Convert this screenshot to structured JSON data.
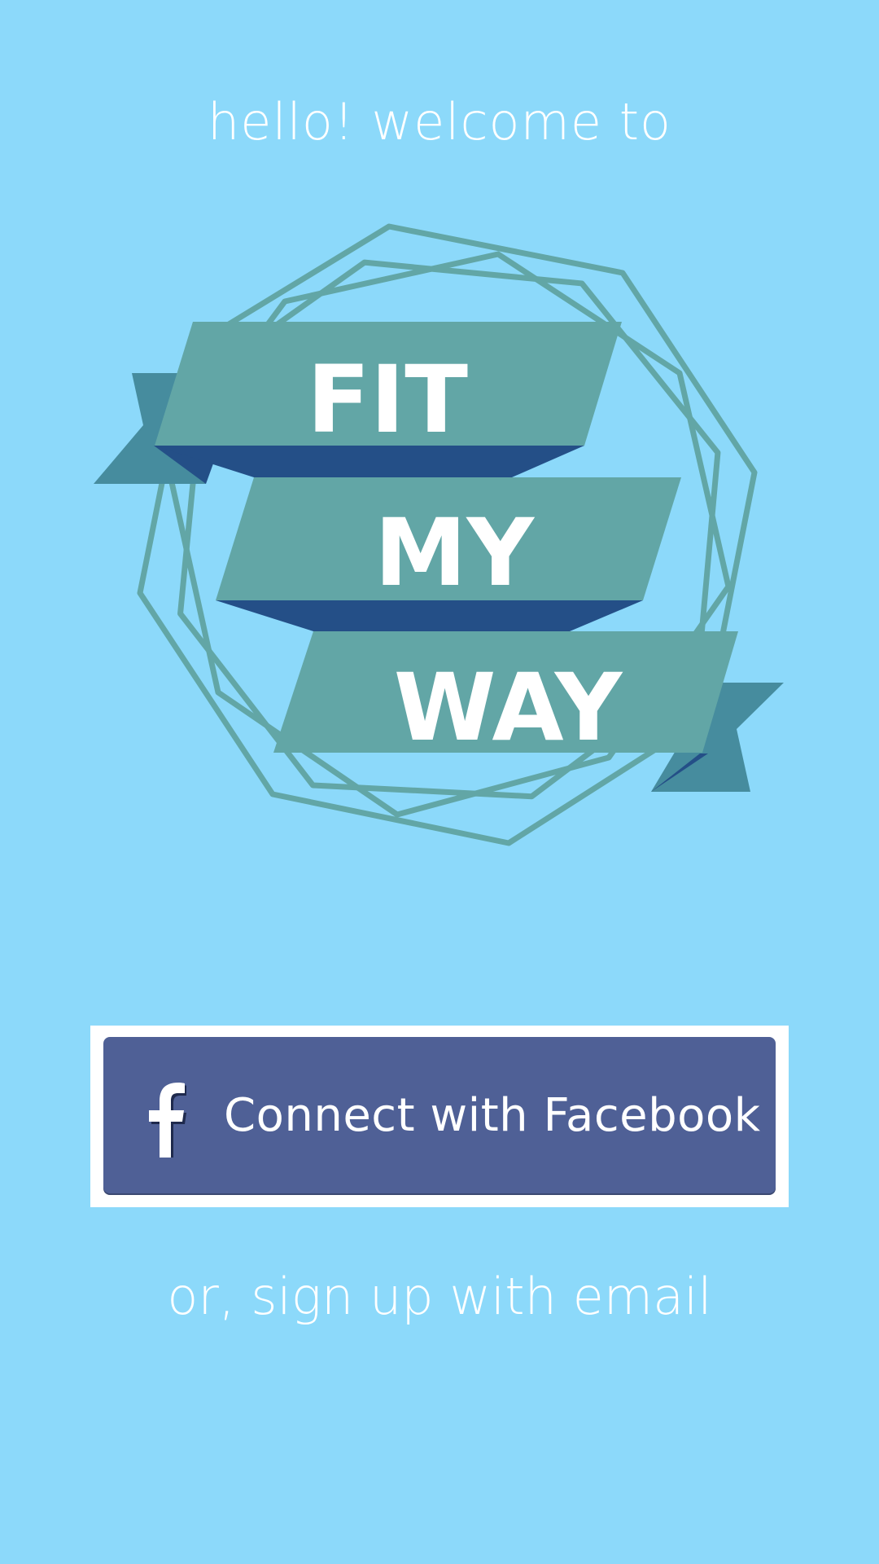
{
  "welcome_text": "hello! welcome to",
  "logo": {
    "line1": "FIT",
    "line2": "MY",
    "line3": "WAY",
    "colors": {
      "frame": "#62a6a6",
      "ribbon": "#62a6a6",
      "ribbon_tail": "#468c9e",
      "ribbon_fold": "#244f87",
      "text": "#ffffff"
    }
  },
  "facebook_button": {
    "label": "Connect with Facebook",
    "icon": "facebook-f-icon",
    "color": "#4f6096"
  },
  "email_signup_text": "or, sign up with email",
  "background_color": "#8cd9fa"
}
